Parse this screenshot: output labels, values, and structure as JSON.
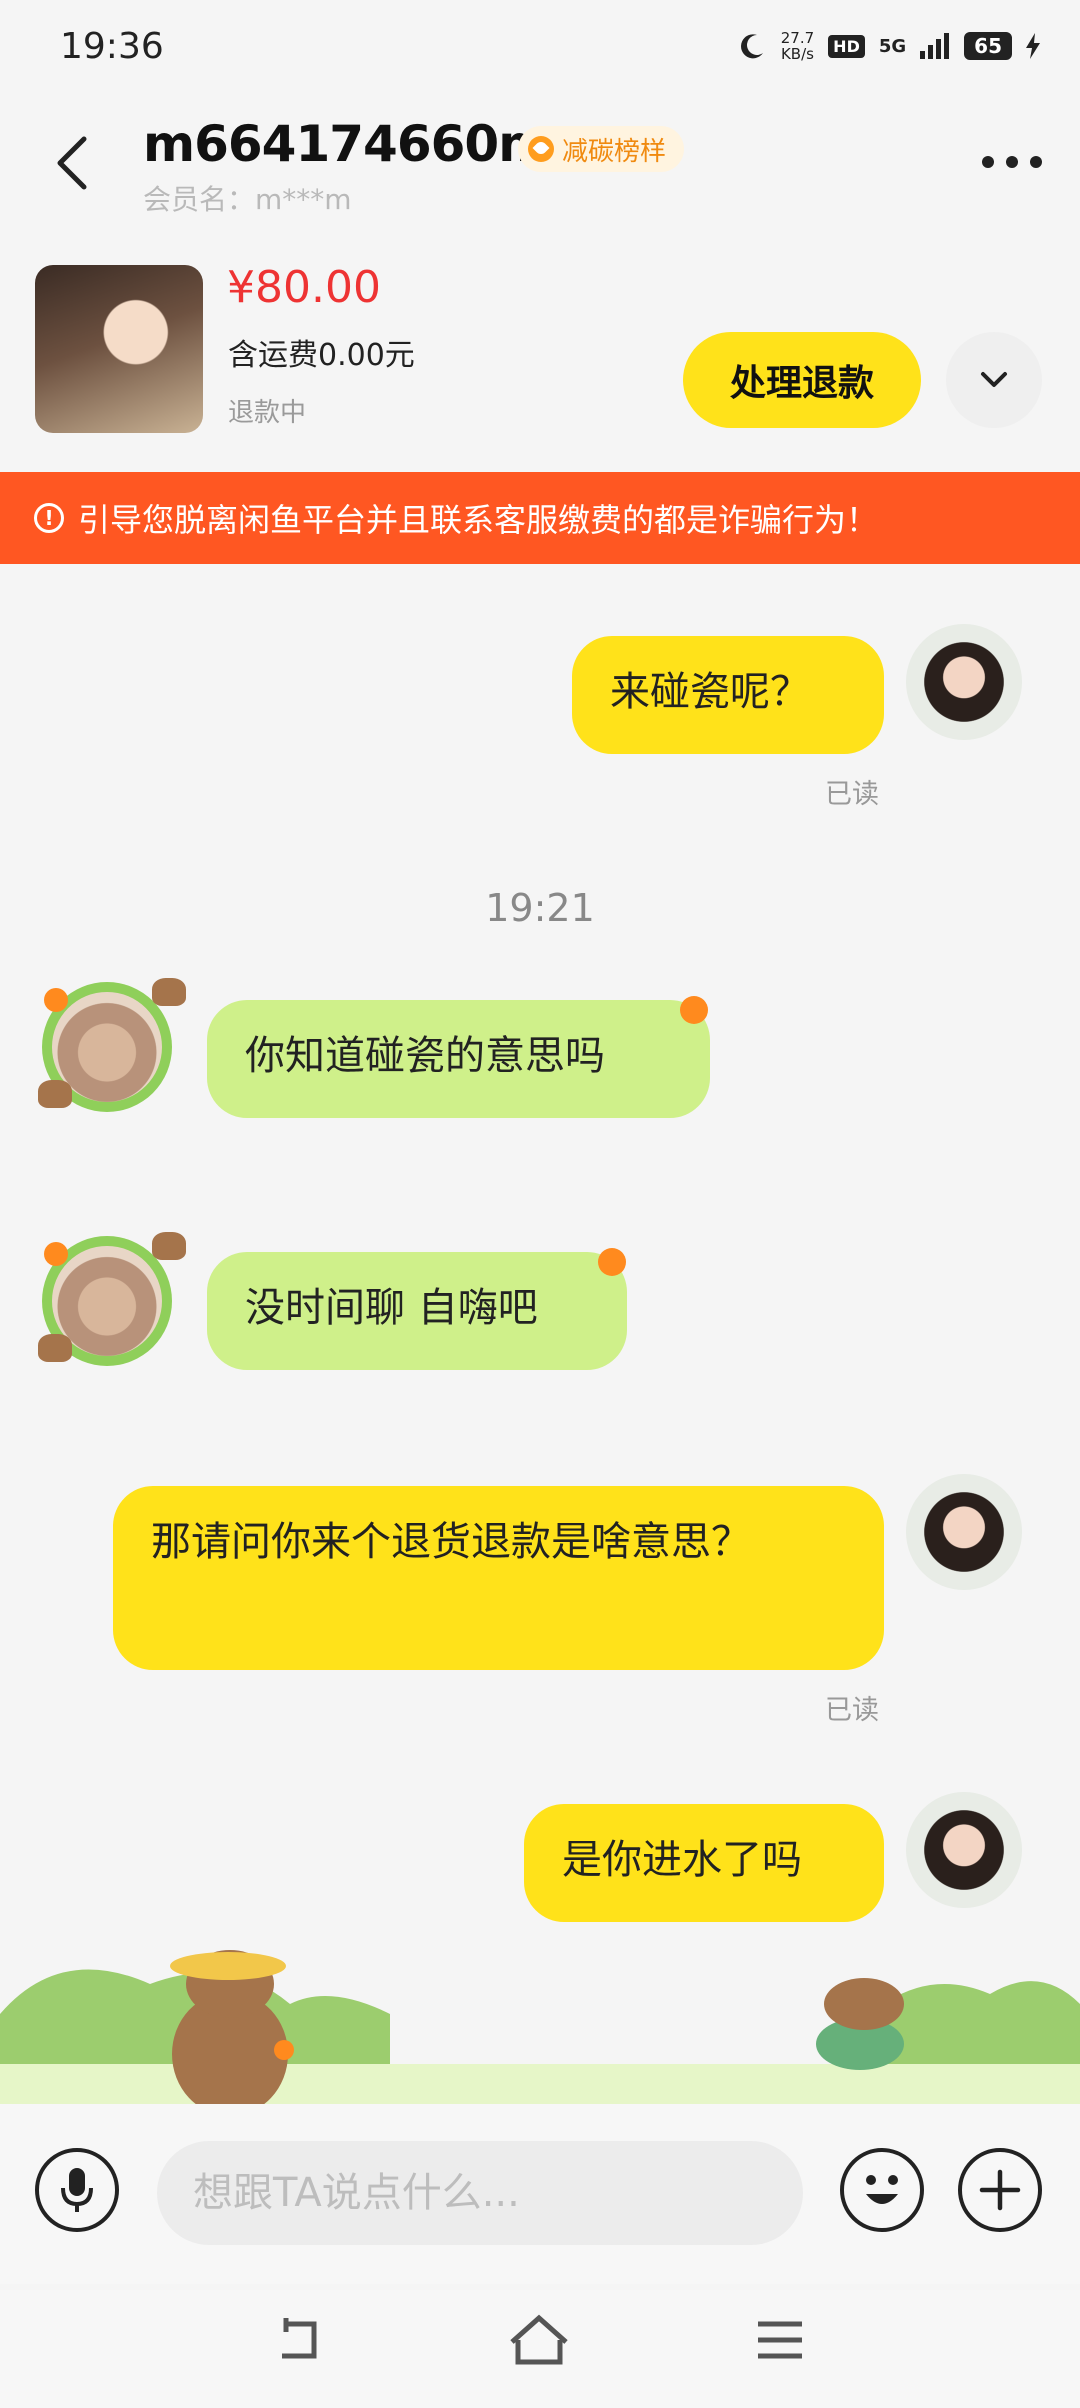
{
  "status_bar": {
    "time": "19:36",
    "speed": "27.7",
    "speed_unit": "KB/s",
    "hd": "HD",
    "network": "5G",
    "battery": "65"
  },
  "header": {
    "nickname": "m664174660m",
    "badge": "减碳榜样",
    "member_name": "会员名：m***m"
  },
  "product": {
    "price": "¥80.00",
    "shipping": "含运费0.00元",
    "status": "退款中",
    "action_label": "处理退款"
  },
  "warning": {
    "text": "引导您脱离闲鱼平台并且联系客服缴费的都是诈骗行为！"
  },
  "messages": [
    {
      "from": "me",
      "text": "来碰瓷呢？",
      "read": "已读"
    },
    {
      "from": "separator",
      "text": "19:21"
    },
    {
      "from": "them",
      "text": "你知道碰瓷的意思吗"
    },
    {
      "from": "them",
      "text": "没时间聊 自嗨吧"
    },
    {
      "from": "me",
      "text": "那请问你来个退货退款是啥意思？",
      "read": "已读"
    },
    {
      "from": "me",
      "text": "是你进水了吗"
    }
  ],
  "input": {
    "placeholder": "想跟TA说点什么..."
  },
  "colors": {
    "accent_yellow": "#ffe21a",
    "warning_orange": "#ff5722",
    "their_bubble": "#cff08a",
    "price_red": "#ee3333"
  },
  "icons": [
    "back-arrow-icon",
    "more-dots-icon",
    "chevron-down-icon",
    "alert-circle-icon",
    "microphone-icon",
    "emoji-icon",
    "plus-icon",
    "back-nav-icon",
    "home-icon",
    "menu-icon"
  ]
}
